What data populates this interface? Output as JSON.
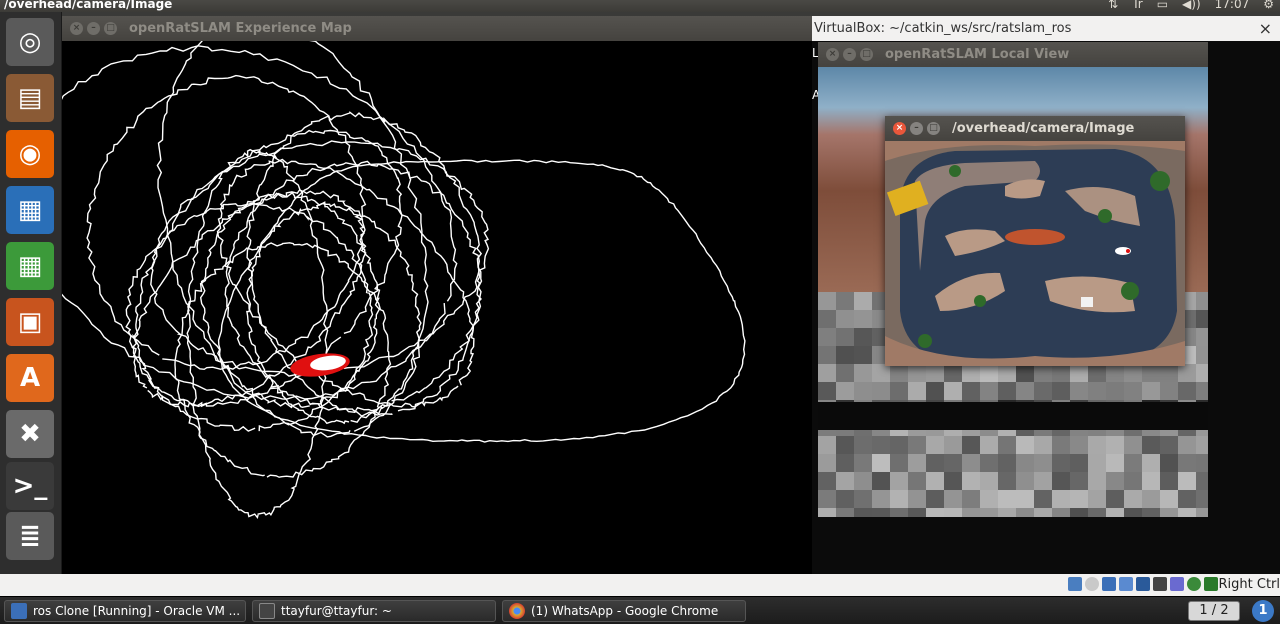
{
  "top_panel": {
    "active_title": "/overhead/camera/Image",
    "indicators": {
      "network": "⇅",
      "keyboard": "Tr",
      "battery": "▭",
      "volume": "◀))",
      "clock": "17:07",
      "settings": "⚙"
    }
  },
  "launcher": {
    "items": [
      {
        "name": "dash-home",
        "icon": "ubuntu-logo-icon",
        "glyph": "◎",
        "color": "#5a5a5a"
      },
      {
        "name": "files",
        "icon": "file-cabinet-icon",
        "glyph": "▤",
        "color": "#8a5a35"
      },
      {
        "name": "firefox",
        "icon": "firefox-icon",
        "glyph": "◉",
        "color": "#e66000"
      },
      {
        "name": "libreoffice-writer",
        "icon": "writer-document-icon",
        "glyph": "▦",
        "color": "#2a6fb8"
      },
      {
        "name": "libreoffice-calc",
        "icon": "calc-spreadsheet-icon",
        "glyph": "▦",
        "color": "#3c9a3a"
      },
      {
        "name": "libreoffice-impress",
        "icon": "impress-presentation-icon",
        "glyph": "▣",
        "color": "#c8541e"
      },
      {
        "name": "software-center",
        "icon": "software-center-bag-icon",
        "glyph": "A",
        "color": "#e0681c"
      },
      {
        "name": "system-settings",
        "icon": "settings-tools-icon",
        "glyph": "✖",
        "color": "#6a6a6a"
      },
      {
        "name": "terminal",
        "icon": "terminal-icon",
        "glyph": ">_",
        "color": "#3a3a3a"
      },
      {
        "name": "workspaces",
        "icon": "workspace-stack-icon",
        "glyph": "≣",
        "color": "#5a5a5a"
      }
    ]
  },
  "windows": {
    "experience_map": {
      "title": "openRatSLAM Experience Map"
    },
    "vbox_host": {
      "title": "VirtualBox: ~/catkin_ws/src/ratslam_ros",
      "close": "×",
      "side_chars": [
        "L",
        "A"
      ]
    },
    "local_view": {
      "title": "openRatSLAM Local View"
    },
    "overhead_camera": {
      "title": "/overhead/camera/Image"
    }
  },
  "vbox_status": {
    "host_key": "Right Ctrl"
  },
  "taskbar": {
    "tasks": [
      {
        "label": "ros Clone [Running] - Oracle VM ...",
        "icon": "virtualbox-icon",
        "color": "#3b6fb8"
      },
      {
        "label": "ttayfur@ttayfur: ~",
        "icon": "terminal-icon",
        "color": "#444444"
      },
      {
        "label": "(1) WhatsApp - Google Chrome",
        "icon": "chrome-icon",
        "color": "#d8b030"
      }
    ],
    "workspace": "1 / 2",
    "workspace_icon": "1"
  },
  "colors": {
    "panel_bg": "#3c3b37",
    "close_button": "#e9573b",
    "trajectory": "#ffffff",
    "robot_marker": "#e01010",
    "water": "#2a3a52",
    "island": "#b99a86"
  }
}
